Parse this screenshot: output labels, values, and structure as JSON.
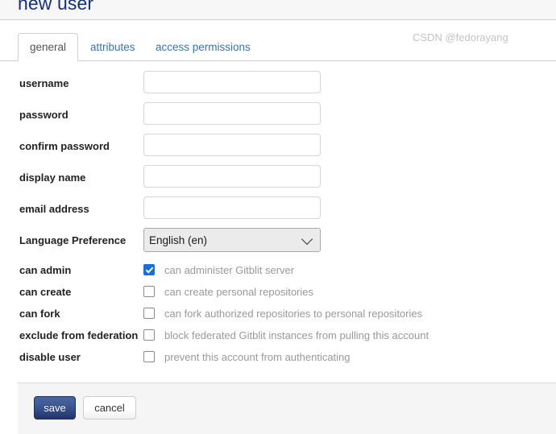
{
  "header": {
    "title": "new user"
  },
  "tabs": [
    {
      "label": "general",
      "active": true
    },
    {
      "label": "attributes",
      "active": false
    },
    {
      "label": "access permissions",
      "active": false
    }
  ],
  "form": {
    "fields": [
      {
        "label": "username",
        "value": "",
        "placeholder": ""
      },
      {
        "label": "password",
        "value": "",
        "placeholder": ""
      },
      {
        "label": "confirm password",
        "value": "",
        "placeholder": ""
      },
      {
        "label": "display name",
        "value": "",
        "placeholder": ""
      },
      {
        "label": "email address",
        "value": "",
        "placeholder": ""
      }
    ],
    "language": {
      "label": "Language Preference",
      "selected": "English (en)",
      "options": [
        "English (en)"
      ]
    },
    "checkboxes": [
      {
        "label": "can admin",
        "description": "can administer Gitblit server",
        "checked": true
      },
      {
        "label": "can create",
        "description": "can create personal repositories",
        "checked": false
      },
      {
        "label": "can fork",
        "description": "can fork authorized repositories to personal repositories",
        "checked": false
      },
      {
        "label": "exclude from federation",
        "description": "block federated Gitblit instances from pulling this account",
        "checked": false
      },
      {
        "label": "disable user",
        "description": "prevent this account from authenticating",
        "checked": false
      }
    ]
  },
  "footer": {
    "save_label": "save",
    "cancel_label": "cancel",
    "watermark": "CSDN @fedorayang"
  },
  "colors": {
    "title": "#15317e",
    "link": "#3b73af",
    "checkbox_checked": "#1470e0",
    "save_button": "#3b5998",
    "footer_bg": "#f5f5f5",
    "header_bg": "#f7f7f7"
  }
}
